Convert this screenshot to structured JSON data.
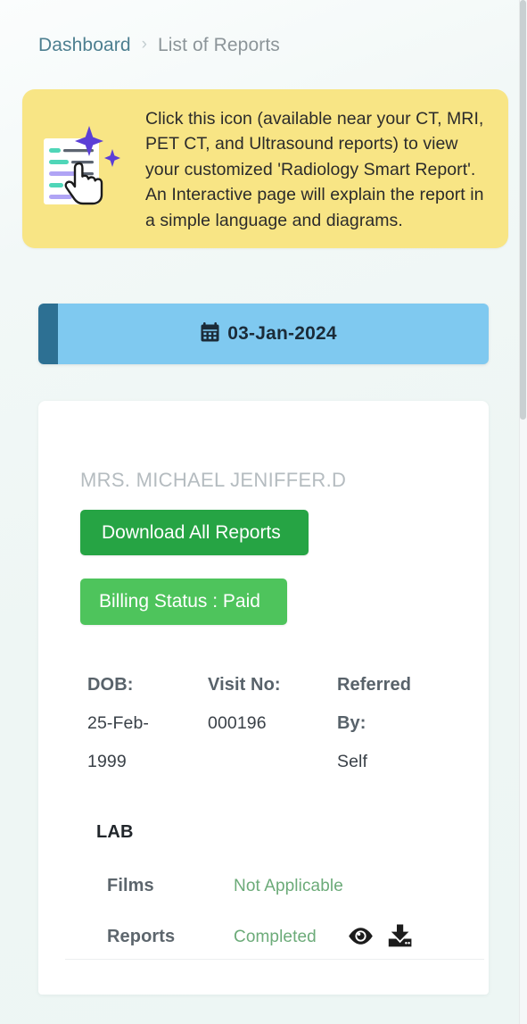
{
  "breadcrumb": {
    "parent": "Dashboard",
    "separator": "›",
    "current": "List of Reports"
  },
  "info_banner": {
    "icon": "smart-report-document-icon",
    "message": "Click this icon (available near your CT, MRI, PET CT, and Ultrasound reports) to view your customized 'Radiology Smart Report'. An Interactive page will explain the report in a simple language and diagrams.",
    "background_color": "#f8e585"
  },
  "date_bar": {
    "icon": "calendar-icon",
    "date": "03-Jan-2024",
    "accent_color": "#2d7093",
    "background_color": "#7fc9f0"
  },
  "report_card": {
    "patient_name": "MRS. MICHAEL JENIFFER.D",
    "download_all_label": "Download All Reports",
    "download_all_color": "#26a444",
    "billing_status_label": "Billing Status : Paid",
    "billing_status_color": "#4ec45c",
    "details": [
      {
        "label": "DOB:",
        "value": "25-Feb-1999"
      },
      {
        "label": "Visit No:",
        "value": "000196"
      },
      {
        "label": "Referred By:",
        "value": "Self"
      }
    ],
    "details_labels": {
      "dob": "DOB:",
      "visit_no": "Visit No:",
      "referred_by_line1": "Referred",
      "referred_by_line2": "By:"
    },
    "details_values": {
      "dob_line1": "25-Feb-",
      "dob_line2": "1999",
      "visit_no": "000196",
      "referred_by": "Self"
    },
    "section_title": "LAB",
    "rows": [
      {
        "label": "Films",
        "status": "Not Applicable",
        "actions": []
      },
      {
        "label": "Reports",
        "status": "Completed",
        "actions": [
          "eye-icon",
          "download-icon"
        ]
      }
    ],
    "row_films_label": "Films",
    "row_films_status": "Not Applicable",
    "row_reports_label": "Reports",
    "row_reports_status": "Completed",
    "status_color": "#6cab79"
  }
}
